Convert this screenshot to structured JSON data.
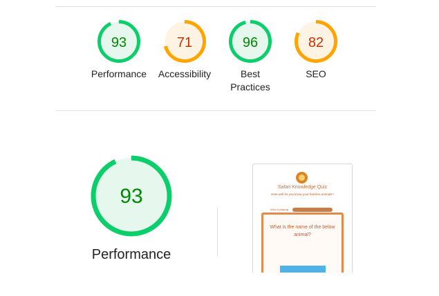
{
  "summary": {
    "gauges": [
      {
        "label": "Performance",
        "score": "93",
        "fraction": 0.93,
        "color": "#0cce6b",
        "bg": "#e6f8ee",
        "text": "#008800"
      },
      {
        "label": "Accessibility",
        "score": "71",
        "fraction": 0.71,
        "color": "#ffa400",
        "bg": "#fff3e3",
        "text": "#c33300"
      },
      {
        "label": "Best Practices",
        "score": "96",
        "fraction": 0.96,
        "color": "#0cce6b",
        "bg": "#e6f8ee",
        "text": "#008800"
      },
      {
        "label": "SEO",
        "score": "82",
        "fraction": 0.82,
        "color": "#ffa400",
        "bg": "#fff3e3",
        "text": "#c33300"
      }
    ]
  },
  "performance": {
    "score": "93",
    "fraction": 0.93,
    "label": "Performance",
    "color": "#0cce6b",
    "bg": "#e6f8ee",
    "text": "#008800"
  },
  "screenshot": {
    "title": "Safari Knowledge Quiz",
    "subtitle": "How well do you know your fearless animals?",
    "who_label": "Who is playing",
    "question": "What is the name of the below animal?"
  }
}
